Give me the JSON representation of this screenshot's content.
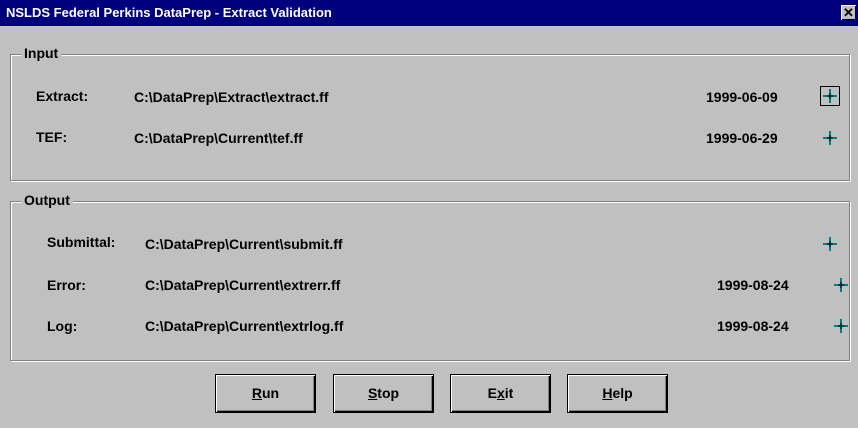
{
  "window": {
    "title": "NSLDS Federal Perkins DataPrep - Extract Validation",
    "close_glyph": "✕"
  },
  "input": {
    "legend": "Input",
    "rows": [
      {
        "label": "Extract:",
        "path": "C:\\DataPrep\\Extract\\extract.ff",
        "date": "1999-06-09",
        "focused": true
      },
      {
        "label": "TEF:",
        "path": "C:\\DataPrep\\Current\\tef.ff",
        "date": "1999-06-29",
        "focused": false
      }
    ]
  },
  "output": {
    "legend": "Output",
    "rows": [
      {
        "label": "Submittal:",
        "path": "C:\\DataPrep\\Current\\submit.ff",
        "date": ""
      },
      {
        "label": "Error:",
        "path": "C:\\DataPrep\\Current\\extrerr.ff",
        "date": "1999-08-24"
      },
      {
        "label": "Log:",
        "path": "C:\\DataPrep\\Current\\extrlog.ff",
        "date": "1999-08-24"
      }
    ]
  },
  "buttons": {
    "run": {
      "pre": "",
      "u": "R",
      "post": "un"
    },
    "stop": {
      "pre": "",
      "u": "S",
      "post": "top"
    },
    "exit": {
      "pre": "E",
      "u": "x",
      "post": "it"
    },
    "help": {
      "pre": "",
      "u": "H",
      "post": "elp"
    }
  },
  "icons": {
    "browse": "crosshair-browse-icon",
    "accent": "#008080"
  }
}
